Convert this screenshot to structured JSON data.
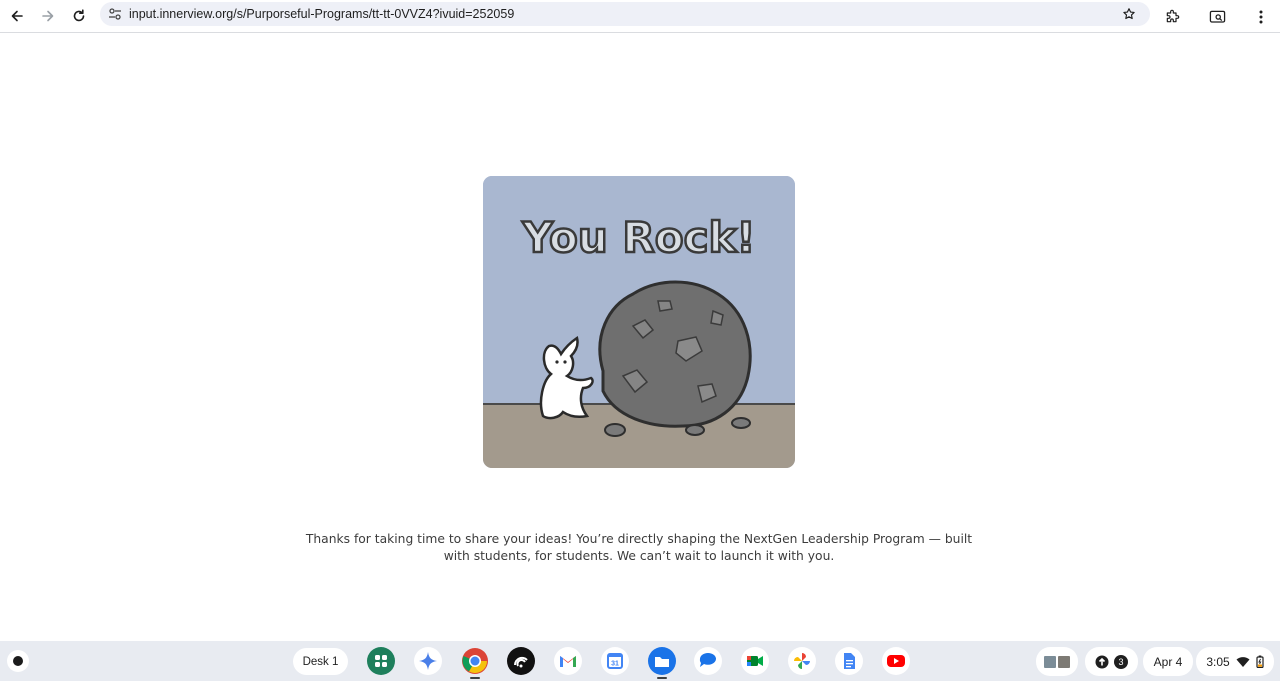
{
  "browser": {
    "url": "input.innerview.org/s/Purporseful-Programs/tt-tt-0VVZ4?ivuid=252059"
  },
  "page": {
    "image_text": "You Rock!",
    "message": "Thanks for taking  time to share your ideas! You’re directly shaping the NextGen Leadership Program — built with students, for students. We can’t wait to launch it with you."
  },
  "shelf": {
    "desk_label": "Desk 1",
    "apps": [
      "launcher-apps",
      "gemini",
      "chrome",
      "podcast",
      "gmail",
      "calendar",
      "files",
      "messages",
      "meet",
      "photos",
      "docs",
      "youtube"
    ],
    "calendar_day": "31",
    "notification_count": "3",
    "date": "Apr 4",
    "time": "3:05"
  },
  "colors": {
    "card_sky": "#a9b7d0",
    "card_ground": "#a39a8d",
    "shelf_bg": "#e8ebf1"
  }
}
